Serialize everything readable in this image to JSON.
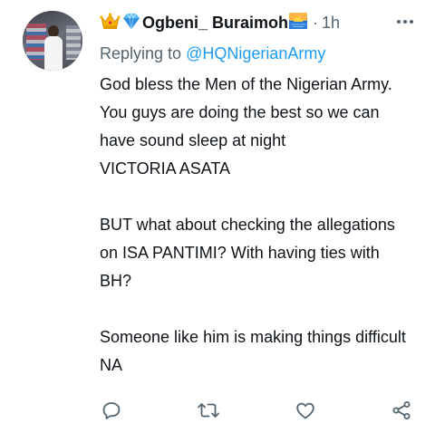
{
  "tweet": {
    "display_name": "Ogbeni_ Buraimoh",
    "emoji_prefix": [
      "crown-icon",
      "gem-icon"
    ],
    "emoji_suffix": "sunrise-icon",
    "separator": "·",
    "time": "1h",
    "replying_prefix": "Replying to",
    "replying_handle": "@HQNigerianArmy",
    "body": "God bless the Men of the Nigerian Army.\nYou guys are doing the best so we can have sound sleep at night\nVICTORIA ASATA\n\nBUT what about checking the allegations on ISA PANTIMI? With having ties with BH?\n\nSomeone like him is making things difficult NA"
  },
  "actions": [
    "reply-icon",
    "retweet-icon",
    "like-icon",
    "share-icon"
  ],
  "colors": {
    "text": "#0f1419",
    "muted": "#536471",
    "link": "#1d9bf0"
  }
}
